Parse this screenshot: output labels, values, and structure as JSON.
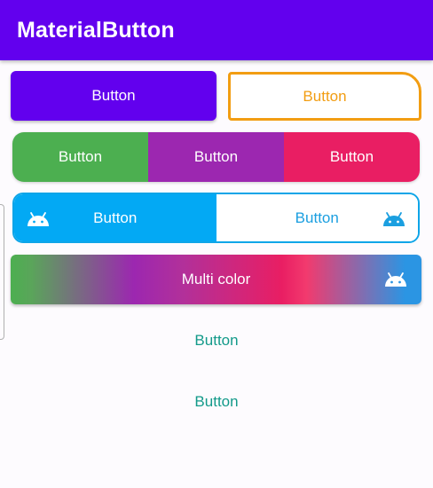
{
  "app_bar": {
    "title": "MaterialButton",
    "color": "#6200ee"
  },
  "buttons": {
    "filled": {
      "label": "Button",
      "color": "#6200ee"
    },
    "outlined": {
      "label": "Button",
      "color": "#f29d12"
    },
    "segmented": [
      {
        "label": "Button",
        "color": "#4caf50"
      },
      {
        "label": "Button",
        "color": "#9c27b0"
      },
      {
        "label": "Button",
        "color": "#e91e63"
      }
    ],
    "toggle": [
      {
        "label": "Button",
        "icon": "android-icon",
        "checked": true,
        "color": "#03a9f4"
      },
      {
        "label": "Button",
        "icon": "android-icon",
        "checked": false,
        "color": "#1b9fe0"
      }
    ],
    "gradient": {
      "label": "Multi color",
      "icon": "android-icon",
      "colors": [
        "#4caf50",
        "#9c27b0",
        "#e91e63",
        "#2b95e3"
      ]
    },
    "text_buttons": [
      {
        "label": "Button",
        "color": "#139a8a"
      },
      {
        "label": "Button",
        "color": "#139a8a"
      }
    ]
  }
}
